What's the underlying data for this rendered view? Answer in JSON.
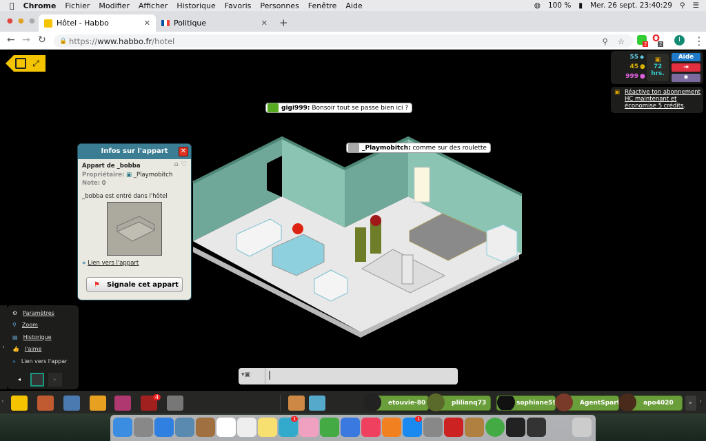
{
  "menubar": {
    "apple": "",
    "app": "Chrome",
    "items": [
      "Fichier",
      "Modifier",
      "Afficher",
      "Historique",
      "Favoris",
      "Personnes",
      "Fenêtre",
      "Aide"
    ],
    "battery": "100 %",
    "datetime": "Mer. 26 sept.  23:40:29"
  },
  "tabs": [
    {
      "label": "Hôtel - Habbo",
      "active": true
    },
    {
      "label": "Politique",
      "active": false
    }
  ],
  "address": {
    "scheme": "https://",
    "host": "www.habbo.fr",
    "path": "/hotel",
    "profile_initial": "I",
    "ext_badges": [
      "2",
      "2"
    ]
  },
  "chat_bubbles": [
    {
      "user": "gigi999:",
      "text": "Bonsoir tout se passe bien ici ?"
    },
    {
      "user": "_Playmobitch:",
      "text": "comme sur des roulette"
    }
  ],
  "room_info": {
    "title": "Infos sur l'appart",
    "room_name": "Appart de _bobba",
    "owner_label": "Propriétaire:",
    "owner": "_Playmobitch",
    "rating_label": "Note:",
    "rating": "0",
    "description": "_bobba est entré dans l'hôtel",
    "link": "Lien vers l'appart",
    "report": "Signale cet appart"
  },
  "side_menu": [
    {
      "icon": "gear-icon",
      "label": "Paramètres"
    },
    {
      "icon": "zoom-icon",
      "label": "Zoom"
    },
    {
      "icon": "history-icon",
      "label": "Historique"
    },
    {
      "icon": "like-icon",
      "label": "J'aime"
    },
    {
      "icon": "link-icon",
      "label": "Lien vers l'appar"
    }
  ],
  "hud": {
    "diamonds": "55",
    "credits": "45",
    "duckets": "999",
    "hc": "72",
    "hc_unit": "hrs.",
    "help": "Aide",
    "colors": {
      "diamonds": "#5fc8e0",
      "credits": "#d8b000",
      "duckets": "#e060e0",
      "help": "#1f7ac9",
      "exit": "#e03040",
      "settings": "#7a6a9e"
    }
  },
  "hc_notice": "Réactive ton abonnement HC maintenant et économise 5 crédits",
  "toolbar": {
    "messenger_badge": "4"
  },
  "friends": [
    "etouvie-80",
    "plilianq73",
    "sophiane5951(",
    "AgentSpart12",
    "apo4020"
  ],
  "dock_badges": [
    "1",
    "1"
  ]
}
